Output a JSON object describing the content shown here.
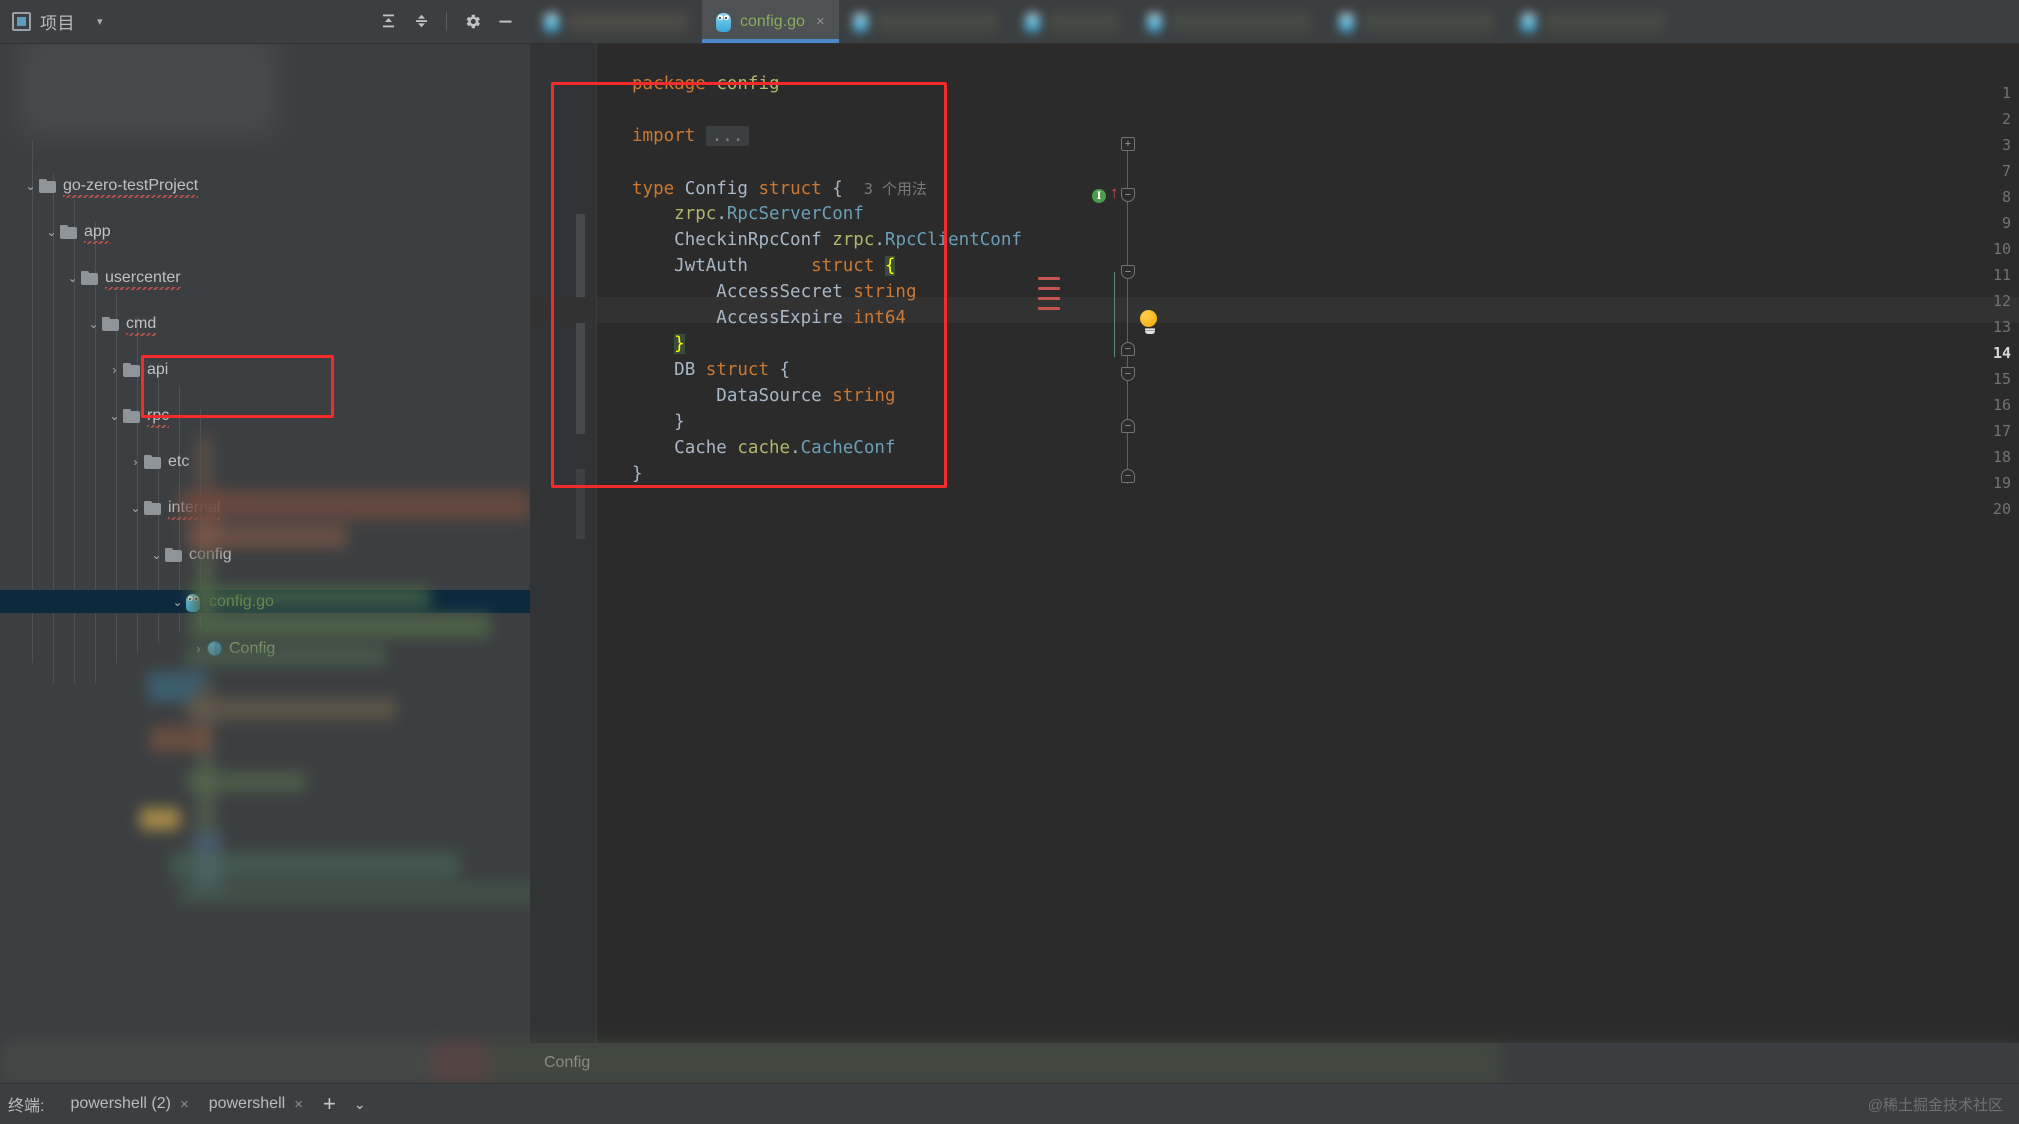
{
  "tool_window": {
    "title": "项目",
    "icon": "project-panel-icon",
    "caret": "▾",
    "actions": [
      {
        "name": "expand-all-icon",
        "label": "展开全部"
      },
      {
        "name": "collapse-all-icon",
        "label": "折叠全部"
      },
      {
        "name": "settings-gear-icon",
        "label": "设置"
      },
      {
        "name": "hide-icon",
        "label": "隐藏"
      }
    ]
  },
  "tree": {
    "nodes": [
      {
        "label": "go-zero-testProject",
        "depth": 0,
        "expanded": true,
        "type": "folder",
        "spell": true
      },
      {
        "label": "app",
        "depth": 1,
        "expanded": true,
        "type": "folder",
        "spell": true
      },
      {
        "label": "usercenter",
        "depth": 2,
        "expanded": true,
        "type": "folder",
        "spell": true
      },
      {
        "label": "cmd",
        "depth": 3,
        "expanded": true,
        "type": "folder",
        "spell": true
      },
      {
        "label": "api",
        "depth": 4,
        "expanded": false,
        "type": "folder",
        "spell": false
      },
      {
        "label": "rpc",
        "depth": 4,
        "expanded": true,
        "type": "folder",
        "spell": true
      },
      {
        "label": "etc",
        "depth": 5,
        "expanded": false,
        "type": "folder",
        "spell": false
      },
      {
        "label": "internal",
        "depth": 5,
        "expanded": true,
        "type": "folder",
        "spell": true
      },
      {
        "label": "config",
        "depth": 6,
        "expanded": true,
        "type": "folder",
        "spell": false
      },
      {
        "label": "config.go",
        "depth": 7,
        "expanded": true,
        "type": "gofile",
        "selected": true,
        "spell": false
      },
      {
        "label": "Config",
        "depth": 8,
        "expanded": false,
        "type": "symbol",
        "spell": false
      }
    ]
  },
  "tabs": {
    "items": [
      {
        "name": "tab-blurred-1",
        "label": "",
        "blurred": true,
        "active": false
      },
      {
        "name": "tab-config-go",
        "label": "config.go",
        "blurred": false,
        "active": true,
        "close": "×",
        "icon": "go-file-icon"
      },
      {
        "name": "tab-blurred-2",
        "label": "",
        "blurred": true,
        "active": false
      },
      {
        "name": "tab-blurred-3",
        "label": "",
        "blurred": true,
        "active": false
      },
      {
        "name": "tab-blurred-4",
        "label": "",
        "blurred": true,
        "active": false
      },
      {
        "name": "tab-blurred-5",
        "label": "",
        "blurred": true,
        "active": false
      },
      {
        "name": "tab-blurred-6",
        "label": "",
        "blurred": true,
        "active": false
      }
    ]
  },
  "code": {
    "filename": "config.go",
    "line_numbers": [
      "1",
      "2",
      "3",
      "7",
      "8",
      "9",
      "10",
      "11",
      "12",
      "13",
      "14",
      "15",
      "16",
      "17",
      "18",
      "19",
      "20"
    ],
    "current_line": "14",
    "inlay_hint": "3 个用法",
    "lines": [
      {
        "n": "1",
        "text": "package config"
      },
      {
        "n": "2",
        "text": ""
      },
      {
        "n": "3",
        "text": "import ..."
      },
      {
        "n": "7",
        "text": ""
      },
      {
        "n": "8",
        "text": "type Config struct {"
      },
      {
        "n": "9",
        "text": "    zrpc.RpcServerConf"
      },
      {
        "n": "10",
        "text": "    CheckinRpcConf zrpc.RpcClientConf"
      },
      {
        "n": "11",
        "text": "    JwtAuth      struct {"
      },
      {
        "n": "12",
        "text": "        AccessSecret string"
      },
      {
        "n": "13",
        "text": "        AccessExpire int64"
      },
      {
        "n": "14",
        "text": "    }"
      },
      {
        "n": "15",
        "text": "    DB struct {"
      },
      {
        "n": "16",
        "text": "        DataSource string"
      },
      {
        "n": "17",
        "text": "    }"
      },
      {
        "n": "18",
        "text": "    Cache cache.CacheConf"
      },
      {
        "n": "19",
        "text": "}"
      },
      {
        "n": "20",
        "text": ""
      }
    ]
  },
  "breadcrumb": {
    "text": "Config"
  },
  "bottom": {
    "terminal_label": "终端:",
    "tabs": [
      {
        "label": "powershell (2)",
        "close": "×"
      },
      {
        "label": "powershell",
        "close": "×"
      }
    ],
    "add": "+",
    "chevron": "⌄",
    "watermark": "@稀土掘金技术社区"
  },
  "colors": {
    "accent_blue": "#4a88c7",
    "annotation_red": "#f52a2a",
    "keyword_orange": "#cc7832",
    "string_green": "#8bab5a",
    "type_blue": "#6a9fb5",
    "package_yellow": "#b5b56a",
    "selection_blue": "#0d293e"
  }
}
